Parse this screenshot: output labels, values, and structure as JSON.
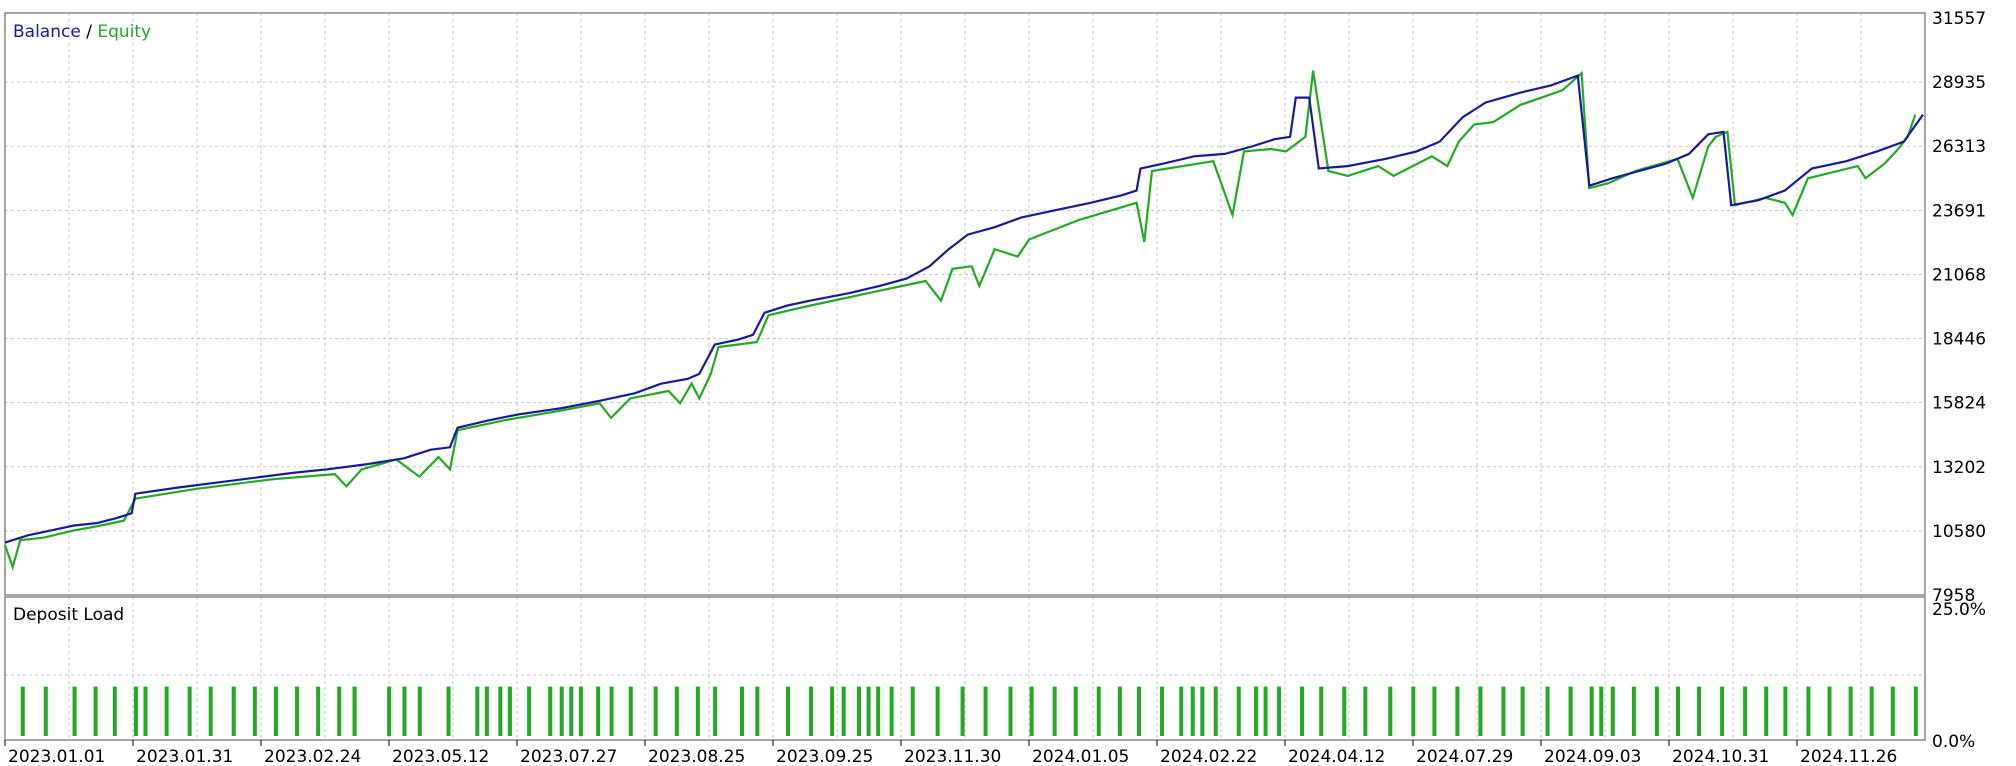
{
  "legend": {
    "balance_label": "Balance",
    "separator": " / ",
    "equity_label": "Equity",
    "balance_color": "#1a1a99",
    "equity_color": "#22aa22"
  },
  "deposit_panel": {
    "title": "Deposit Load",
    "y_top_label": "25.0%",
    "y_bottom_label": "0.0%",
    "bar_color": "#22aa22"
  },
  "colors": {
    "grid": "#c8c8c8",
    "frame": "#888888",
    "background": "#ffffff"
  },
  "chart_data": [
    {
      "type": "line",
      "title": "",
      "legend": [
        "Balance",
        "Equity"
      ],
      "yticks": [
        31557,
        28935,
        26313,
        23691,
        21068,
        18446,
        15824,
        13202,
        10580,
        7958
      ],
      "ylim": [
        7958,
        31557
      ],
      "xticks": [
        "2023.01.01",
        "2023.01.31",
        "2023.02.24",
        "2023.05.12",
        "2023.07.27",
        "2023.08.25",
        "2023.09.25",
        "2023.11.30",
        "2024.01.05",
        "2024.02.22",
        "2024.04.12",
        "2024.07.29",
        "2024.09.03",
        "2024.10.31",
        "2024.11.26"
      ],
      "trade_count": 1000,
      "grid": true,
      "series": [
        {
          "name": "Balance",
          "color": "#1a1a99",
          "points": [
            [
              0,
              10100
            ],
            [
              12,
              10400
            ],
            [
              24,
              10600
            ],
            [
              36,
              10800
            ],
            [
              48,
              10900
            ],
            [
              58,
              11100
            ],
            [
              66,
              11300
            ],
            [
              68,
              12100
            ],
            [
              90,
              12350
            ],
            [
              110,
              12550
            ],
            [
              130,
              12750
            ],
            [
              150,
              12950
            ],
            [
              168,
              13100
            ],
            [
              188,
              13300
            ],
            [
              208,
              13550
            ],
            [
              222,
              13900
            ],
            [
              232,
              14000
            ],
            [
              236,
              14800
            ],
            [
              252,
              15100
            ],
            [
              268,
              15350
            ],
            [
              290,
              15600
            ],
            [
              310,
              15900
            ],
            [
              328,
              16200
            ],
            [
              342,
              16600
            ],
            [
              356,
              16800
            ],
            [
              362,
              17000
            ],
            [
              370,
              18200
            ],
            [
              382,
              18400
            ],
            [
              390,
              18600
            ],
            [
              396,
              19500
            ],
            [
              408,
              19800
            ],
            [
              420,
              20000
            ],
            [
              440,
              20300
            ],
            [
              456,
              20600
            ],
            [
              470,
              20900
            ],
            [
              482,
              21400
            ],
            [
              492,
              22100
            ],
            [
              502,
              22700
            ],
            [
              516,
              23000
            ],
            [
              530,
              23400
            ],
            [
              548,
              23700
            ],
            [
              566,
              24000
            ],
            [
              582,
              24300
            ],
            [
              590,
              24500
            ],
            [
              592,
              25400
            ],
            [
              604,
              25600
            ],
            [
              620,
              25900
            ],
            [
              636,
              26000
            ],
            [
              650,
              26300
            ],
            [
              662,
              26600
            ],
            [
              670,
              26700
            ],
            [
              673,
              28300
            ],
            [
              680,
              28300
            ],
            [
              685,
              25400
            ],
            [
              700,
              25500
            ],
            [
              720,
              25800
            ],
            [
              736,
              26100
            ],
            [
              748,
              26500
            ],
            [
              760,
              27500
            ],
            [
              772,
              28100
            ],
            [
              790,
              28500
            ],
            [
              806,
              28800
            ],
            [
              820,
              29200
            ],
            [
              826,
              24700
            ],
            [
              838,
              25000
            ],
            [
              852,
              25300
            ],
            [
              866,
              25600
            ],
            [
              878,
              26000
            ],
            [
              888,
              26800
            ],
            [
              896,
              26900
            ],
            [
              900,
              23900
            ],
            [
              914,
              24100
            ],
            [
              928,
              24500
            ],
            [
              942,
              25400
            ],
            [
              960,
              25700
            ],
            [
              976,
              26100
            ],
            [
              990,
              26500
            ],
            [
              1000,
              27600
            ]
          ]
        },
        {
          "name": "Equity",
          "color": "#22aa22",
          "points": [
            [
              0,
              10000
            ],
            [
              4,
              9100
            ],
            [
              8,
              10200
            ],
            [
              20,
              10300
            ],
            [
              36,
              10600
            ],
            [
              50,
              10800
            ],
            [
              62,
              11000
            ],
            [
              68,
              11900
            ],
            [
              100,
              12300
            ],
            [
              140,
              12700
            ],
            [
              172,
              12900
            ],
            [
              178,
              12400
            ],
            [
              186,
              13100
            ],
            [
              204,
              13500
            ],
            [
              216,
              12800
            ],
            [
              226,
              13600
            ],
            [
              232,
              13100
            ],
            [
              236,
              14700
            ],
            [
              260,
              15100
            ],
            [
              290,
              15500
            ],
            [
              310,
              15800
            ],
            [
              316,
              15200
            ],
            [
              326,
              16000
            ],
            [
              346,
              16300
            ],
            [
              352,
              15800
            ],
            [
              358,
              16600
            ],
            [
              362,
              16000
            ],
            [
              368,
              17000
            ],
            [
              372,
              18100
            ],
            [
              392,
              18300
            ],
            [
              398,
              19400
            ],
            [
              420,
              19800
            ],
            [
              450,
              20300
            ],
            [
              480,
              20800
            ],
            [
              488,
              20000
            ],
            [
              494,
              21300
            ],
            [
              504,
              21400
            ],
            [
              508,
              20600
            ],
            [
              516,
              22100
            ],
            [
              528,
              21800
            ],
            [
              534,
              22500
            ],
            [
              560,
              23300
            ],
            [
              590,
              24000
            ],
            [
              594,
              22400
            ],
            [
              598,
              25300
            ],
            [
              630,
              25700
            ],
            [
              640,
              23500
            ],
            [
              646,
              26100
            ],
            [
              660,
              26200
            ],
            [
              668,
              26100
            ],
            [
              678,
              26700
            ],
            [
              682,
              29400
            ],
            [
              690,
              25300
            ],
            [
              700,
              25100
            ],
            [
              716,
              25500
            ],
            [
              724,
              25100
            ],
            [
              744,
              25900
            ],
            [
              752,
              25500
            ],
            [
              758,
              26500
            ],
            [
              766,
              27200
            ],
            [
              776,
              27300
            ],
            [
              790,
              28000
            ],
            [
              812,
              28600
            ],
            [
              822,
              29300
            ],
            [
              826,
              24600
            ],
            [
              836,
              24800
            ],
            [
              850,
              25300
            ],
            [
              872,
              25800
            ],
            [
              880,
              24200
            ],
            [
              888,
              26300
            ],
            [
              892,
              26700
            ],
            [
              898,
              26900
            ],
            [
              902,
              23900
            ],
            [
              918,
              24200
            ],
            [
              928,
              24000
            ],
            [
              932,
              23500
            ],
            [
              940,
              25000
            ],
            [
              966,
              25500
            ],
            [
              970,
              25000
            ],
            [
              980,
              25600
            ],
            [
              986,
              26100
            ],
            [
              992,
              26700
            ],
            [
              996,
              27600
            ]
          ]
        }
      ]
    },
    {
      "type": "bar",
      "title": "Deposit Load",
      "ylim": [
        0,
        25
      ],
      "yticks": [
        "25.0%",
        "0.0%"
      ],
      "bar_positions": [
        3,
        15,
        30,
        41,
        51,
        62,
        67,
        78,
        90,
        101,
        113,
        124,
        135,
        146,
        157,
        168,
        176,
        194,
        202,
        210,
        225,
        240,
        245,
        252,
        257,
        267,
        278,
        284,
        289,
        294,
        303,
        310,
        320,
        333,
        344,
        355,
        364,
        378,
        386,
        402,
        414,
        425,
        431,
        439,
        444,
        449,
        456,
        467,
        480,
        493,
        505,
        518,
        529,
        541,
        552,
        564,
        575,
        585,
        597,
        607,
        613,
        618,
        625,
        637,
        646,
        651,
        658,
        670,
        680,
        692,
        703,
        716,
        728,
        739,
        751,
        763,
        775,
        785,
        798,
        810,
        821,
        826,
        832,
        843,
        855,
        866,
        877,
        889,
        901,
        912,
        922,
        934,
        945,
        956,
        967,
        978,
        990
      ],
      "values_percent": 9.5
    }
  ]
}
